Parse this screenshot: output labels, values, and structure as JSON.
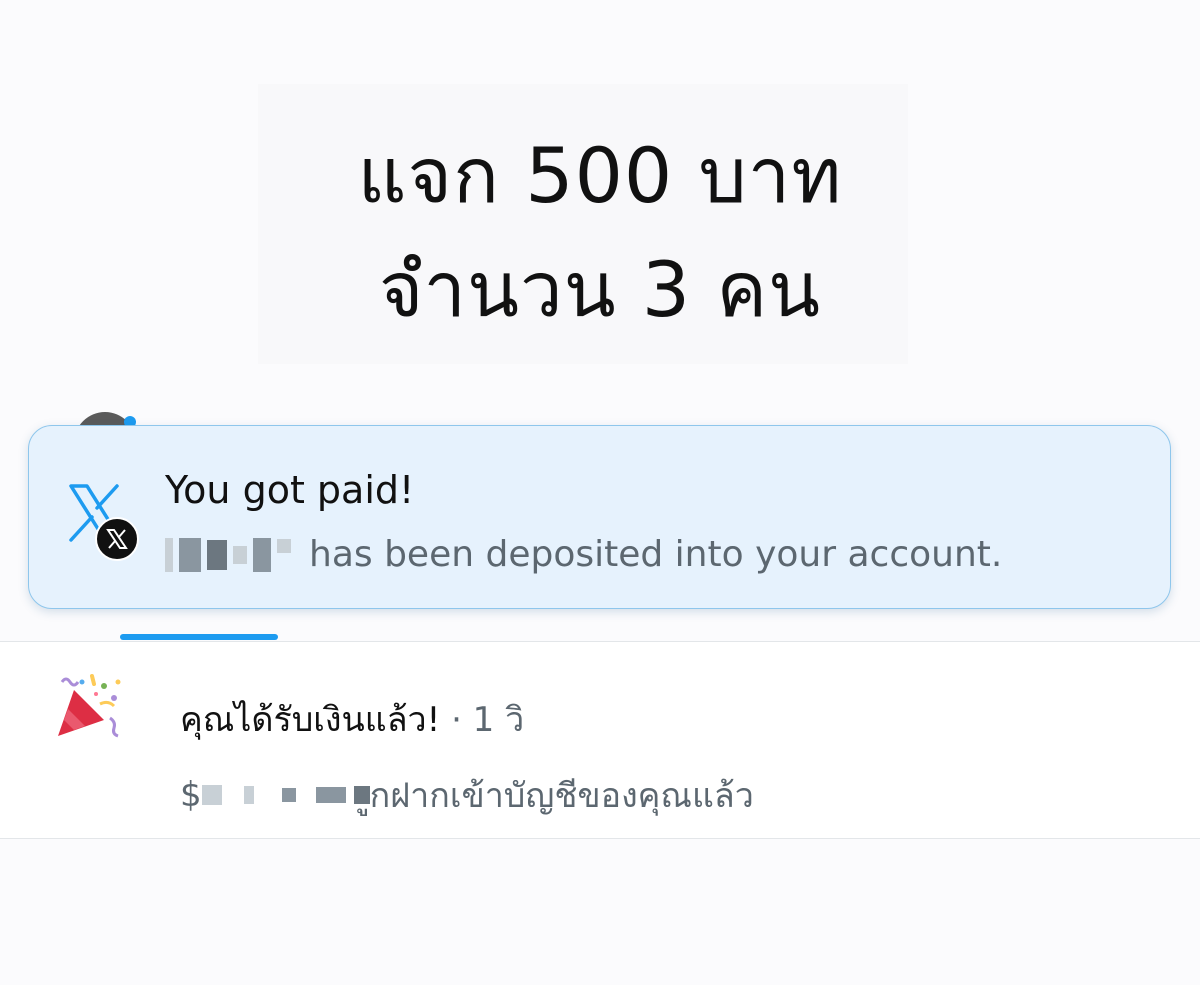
{
  "headline": {
    "line1": "แจก 500 บาท",
    "line2": "จำนวน 3 คน"
  },
  "notification": {
    "app_icon": "x-logo-icon",
    "badge_icon": "x-badge-icon",
    "title": "You got paid!",
    "body": "has been deposited into your account."
  },
  "activity": {
    "icon": "party-popper-icon",
    "title": "คุณได้รับเงินแล้ว!",
    "time": "· 1 วิ",
    "body_prefix": "$",
    "body": "ูกฝากเข้าบัญชีของคุณแล้ว"
  },
  "colors": {
    "accent": "#1d9bf0",
    "notification_bg": "#e6f2fd",
    "secondary_text": "#5c6770"
  }
}
